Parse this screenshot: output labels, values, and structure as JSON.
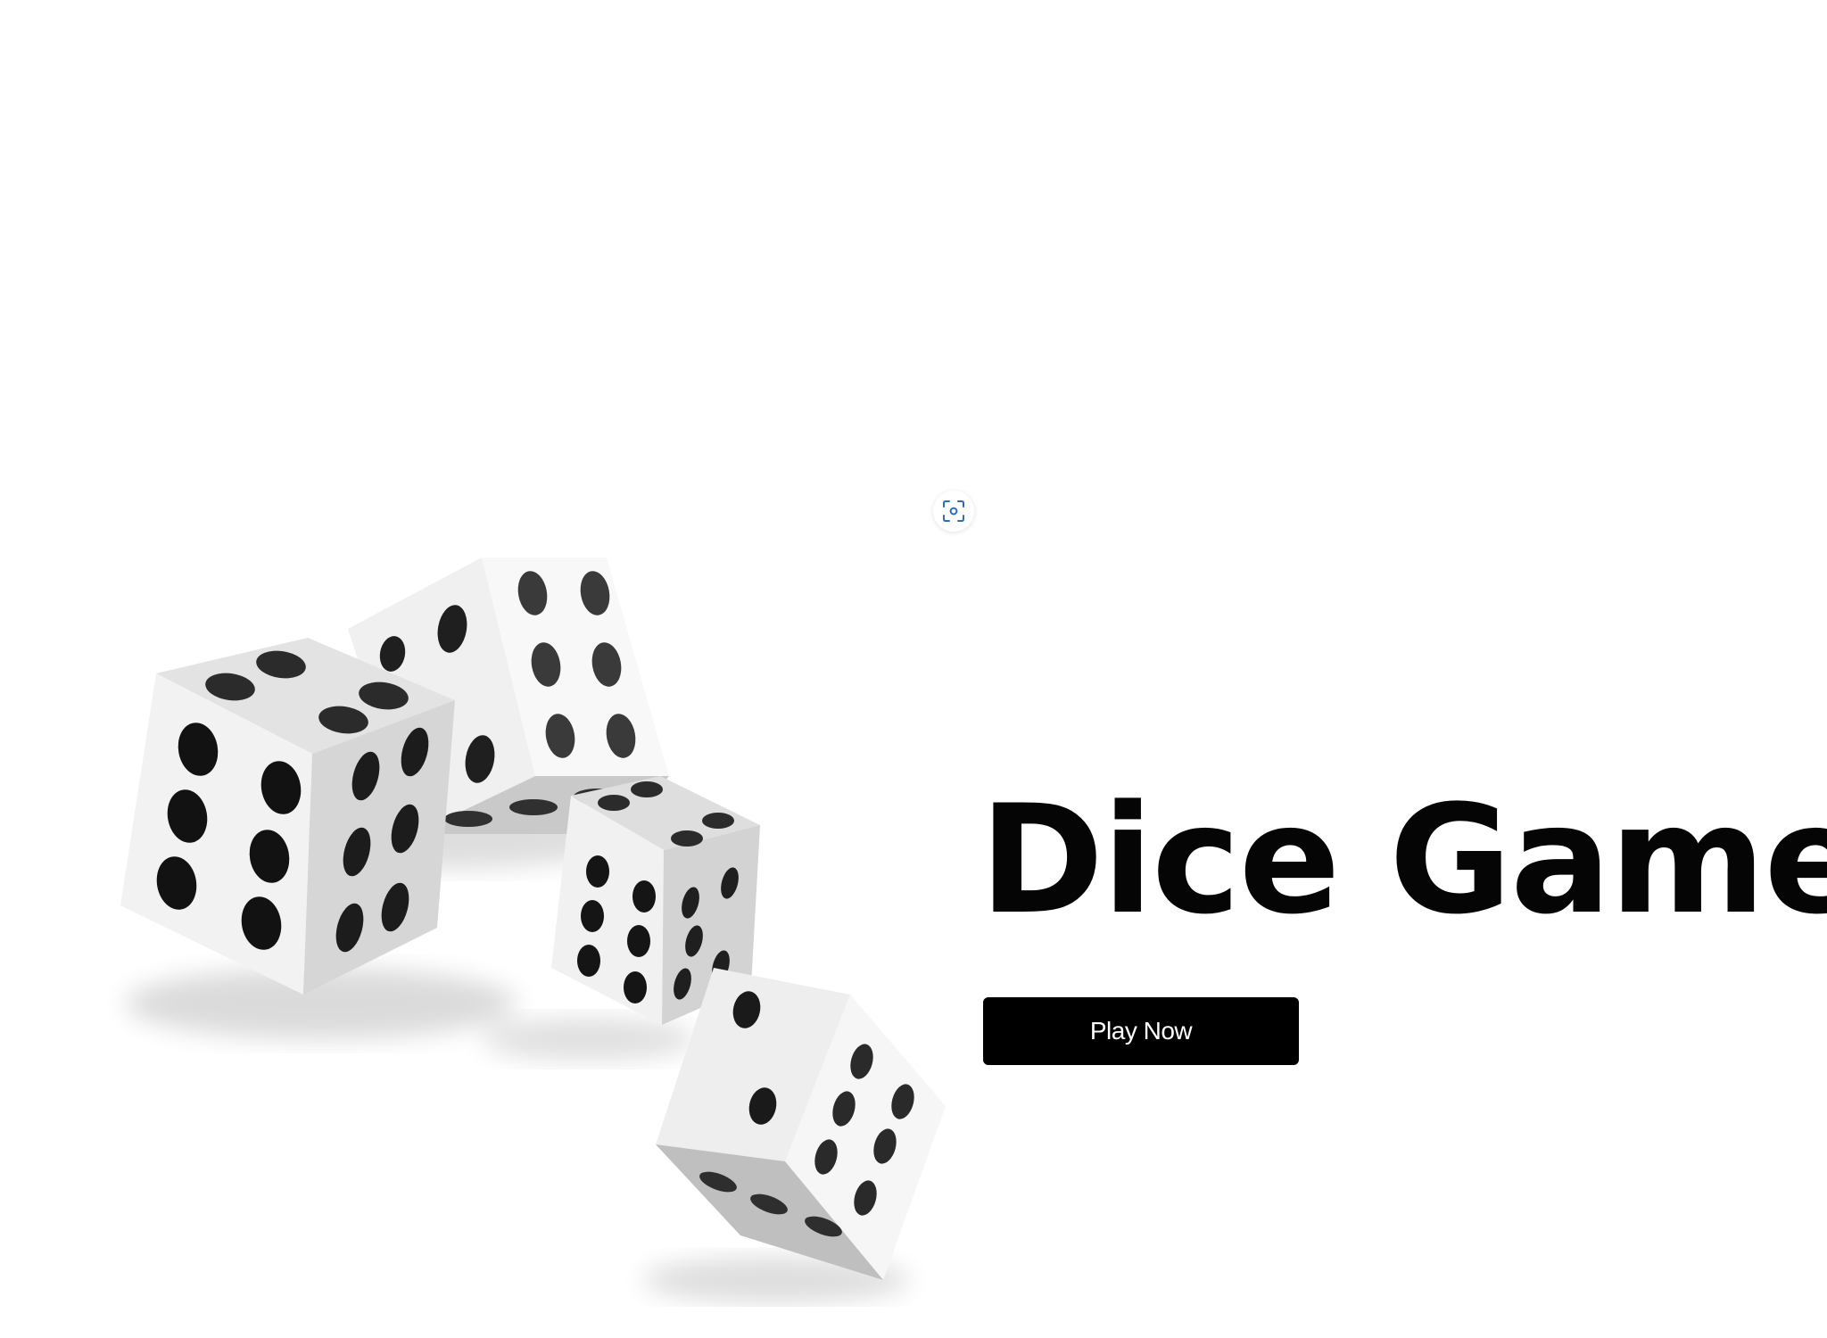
{
  "hero": {
    "title": "Dice Game",
    "play_button_label": "Play Now"
  },
  "icons": {
    "scan": "scan-icon",
    "illustration": "dice-illustration"
  },
  "colors": {
    "background": "#ffffff",
    "title": "#050505",
    "button_background": "#000000",
    "button_text": "#ffffff",
    "scan_icon": "#2f6db5"
  }
}
